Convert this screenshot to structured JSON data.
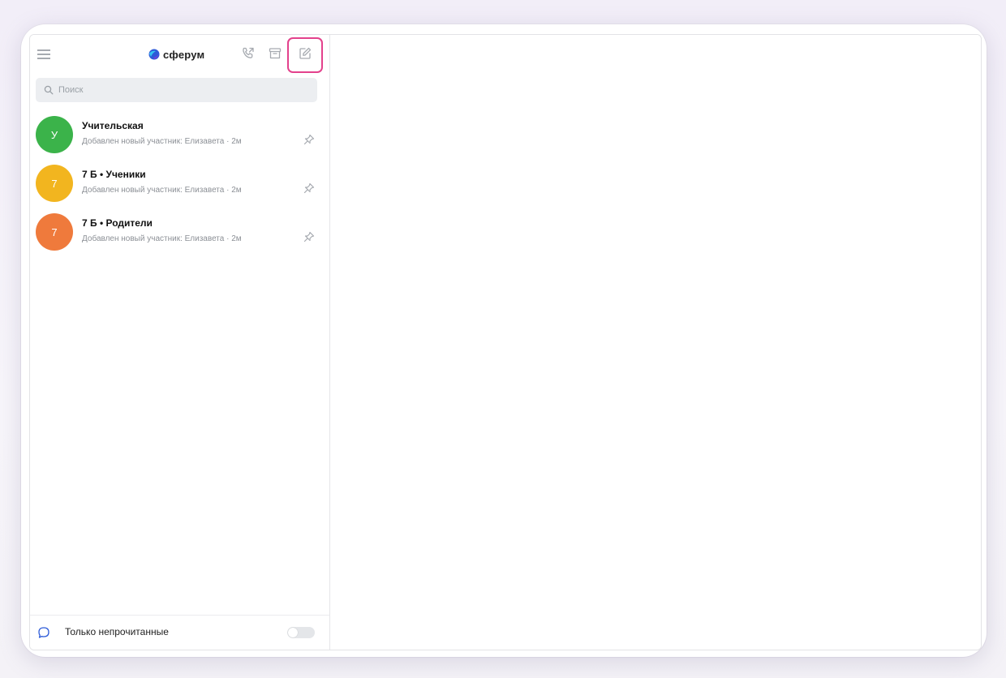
{
  "app": {
    "logo_text": "сферум",
    "brand_color": "#2d5bd8"
  },
  "topbar": {
    "menu_icon": "hamburger-icon",
    "call_icon": "phone-icon",
    "archive_icon": "archive-icon",
    "compose_icon": "compose-icon",
    "highlight_color": "#e3418c"
  },
  "search": {
    "placeholder": "Поиск"
  },
  "chats": [
    {
      "avatar_letter": "У",
      "avatar_color": "#3bb34a",
      "title": "Учительская",
      "preview": "Добавлен новый участник: Елизавета · 2м",
      "pinned": true
    },
    {
      "avatar_letter": "7",
      "avatar_color": "#f2b51f",
      "title": " 7 Б • Ученики",
      "preview": "Добавлен новый участник: Елизавета · 2м",
      "pinned": true
    },
    {
      "avatar_letter": "7",
      "avatar_color": "#ef7a3c",
      "title": "7 Б • Родители",
      "preview": "Добавлен новый участник: Елизавета · 2м",
      "pinned": true
    }
  ],
  "footer": {
    "label": "Только непрочитанные",
    "toggle_on": false
  }
}
